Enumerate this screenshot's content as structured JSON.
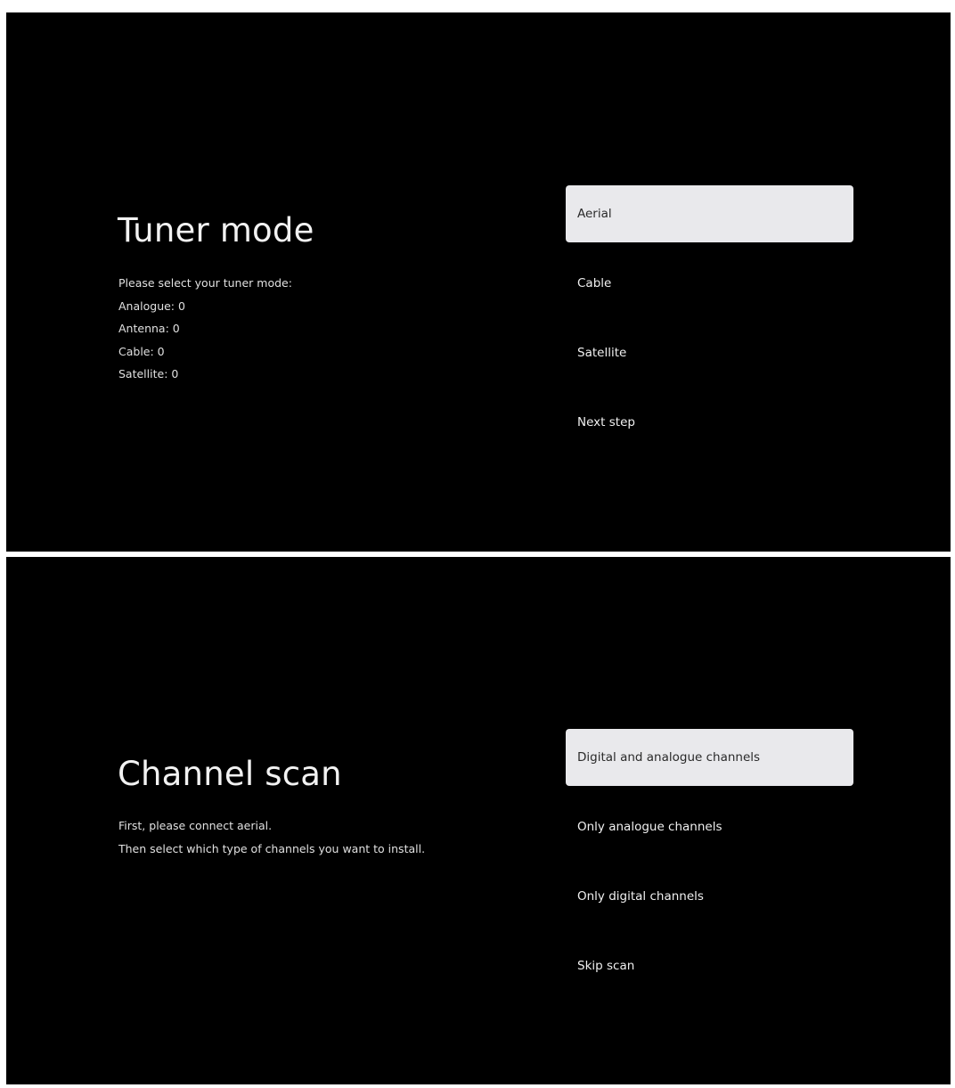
{
  "tuner_screen": {
    "title": "Tuner mode",
    "description_lines": [
      "Please select your tuner mode:",
      "Analogue: 0",
      "Antenna: 0",
      "Cable: 0",
      "Satellite: 0"
    ],
    "options": [
      {
        "label": "Aerial",
        "selected": true
      },
      {
        "label": "Cable",
        "selected": false
      },
      {
        "label": "Satellite",
        "selected": false
      },
      {
        "label": "Next step",
        "selected": false
      }
    ]
  },
  "scan_screen": {
    "title": "Channel scan",
    "description_lines": [
      "First, please connect aerial.",
      "Then select which type of channels you want to install."
    ],
    "options": [
      {
        "label": "Digital and analogue channels",
        "selected": true
      },
      {
        "label": "Only analogue channels",
        "selected": false
      },
      {
        "label": "Only digital channels",
        "selected": false
      },
      {
        "label": "Skip scan",
        "selected": false
      }
    ]
  },
  "colors": {
    "background": "#000000",
    "text": "#ffffff",
    "selected_background": "#e9e9ec",
    "selected_text": "#2a2a2a"
  }
}
